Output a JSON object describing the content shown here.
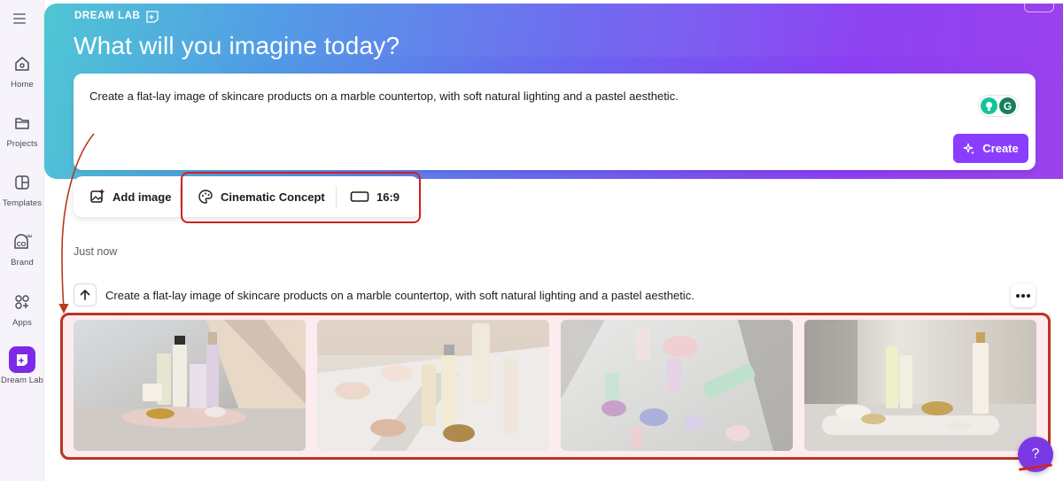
{
  "sidebar": {
    "items": [
      {
        "label": "Home",
        "icon": "home-icon"
      },
      {
        "label": "Projects",
        "icon": "folder-icon"
      },
      {
        "label": "Templates",
        "icon": "templates-icon"
      },
      {
        "label": "Brand",
        "icon": "brand-icon"
      },
      {
        "label": "Apps",
        "icon": "apps-icon"
      },
      {
        "label": "Dream Lab",
        "icon": "dream-lab-icon"
      }
    ]
  },
  "hero": {
    "brand": "DREAM LAB",
    "title": "What will you imagine today?"
  },
  "prompt": {
    "text": "Create a flat-lay image of skincare products on a marble countertop, with soft natural lighting and a pastel aesthetic.",
    "create_label": "Create"
  },
  "toolbar": {
    "add_image": "Add image",
    "style": "Cinematic Concept",
    "aspect": "16:9"
  },
  "history": {
    "timestamp": "Just now",
    "prompt": "Create a flat-lay image of skincare products on a marble countertop, with soft natural lighting and a pastel aesthetic.",
    "images": [
      {
        "name": "generated-image-1"
      },
      {
        "name": "generated-image-2"
      },
      {
        "name": "generated-image-3"
      },
      {
        "name": "generated-image-4"
      }
    ]
  },
  "help": {
    "label": "?"
  },
  "colors": {
    "accent": "#8b3dff",
    "annotation_red": "#d11f1f",
    "gallery_frame": "#b7361f"
  }
}
